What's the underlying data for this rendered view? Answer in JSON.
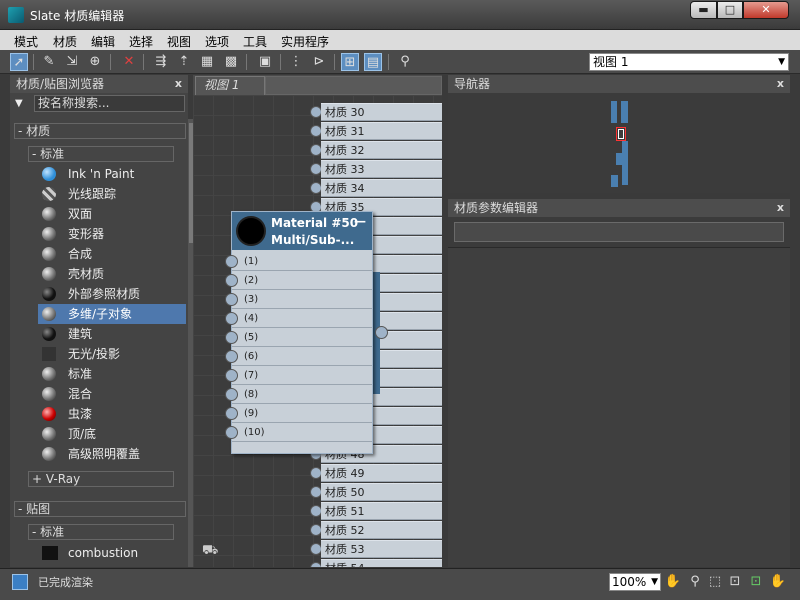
{
  "window": {
    "title": "Slate 材质编辑器",
    "min_label": "▬",
    "max_label": "□",
    "close_label": "✕"
  },
  "menu": [
    "模式",
    "材质",
    "编辑",
    "选择",
    "视图",
    "选项",
    "工具",
    "实用程序"
  ],
  "toolbar": {
    "view_dropdown": "视图 1"
  },
  "browser": {
    "title": "材质/贴图浏览器",
    "close": "x",
    "search_placeholder": "按名称搜索...",
    "materials_group": "- 材质",
    "standard_group": "- 标准",
    "items": [
      {
        "label": "Ink 'n Paint",
        "icon": "blue"
      },
      {
        "label": "光线跟踪",
        "icon": "stripe"
      },
      {
        "label": "双面",
        "icon": "grey"
      },
      {
        "label": "变形器",
        "icon": "grey"
      },
      {
        "label": "合成",
        "icon": "grey"
      },
      {
        "label": "壳材质",
        "icon": "grey"
      },
      {
        "label": "外部参照材质",
        "icon": "black"
      },
      {
        "label": "多维/子对象",
        "icon": "grey",
        "selected": true
      },
      {
        "label": "建筑",
        "icon": "black"
      },
      {
        "label": "无光/投影",
        "icon": "flat"
      },
      {
        "label": "标准",
        "icon": "grey"
      },
      {
        "label": "混合",
        "icon": "grey"
      },
      {
        "label": "虫漆",
        "icon": "red"
      },
      {
        "label": "顶/底",
        "icon": "grey"
      },
      {
        "label": "高级照明覆盖",
        "icon": "grey"
      }
    ],
    "vray_group": "+ V-Ray",
    "maps_group": "- 贴图",
    "maps_standard_group": "- 标准",
    "map_items": [
      {
        "label": "combustion",
        "icon": "darksq"
      }
    ]
  },
  "view": {
    "tab": "视图 1",
    "slots": [
      "材质 30",
      "材质 31",
      "材质 32",
      "材质 33",
      "材质 34",
      "材质 35",
      "",
      "",
      "",
      "",
      "",
      "",
      "",
      "",
      "",
      "",
      "",
      "",
      "材质 48",
      "材质 49",
      "材质 50",
      "材质 51",
      "材质 52",
      "材质 53",
      "材质 54"
    ],
    "node": {
      "title": "Material #50",
      "subtitle": "Multi/Sub-...",
      "minimize": "—",
      "inputs": [
        "(1)",
        "(2)",
        "(3)",
        "(4)",
        "(5)",
        "(6)",
        "(7)",
        "(8)",
        "(9)",
        "(10)"
      ]
    },
    "binoculars": "⛟"
  },
  "navigator": {
    "title": "导航器",
    "close": "x"
  },
  "params": {
    "title": "材质参数编辑器",
    "close": "x"
  },
  "status": {
    "text": "已完成渲染",
    "zoom": "100%"
  }
}
